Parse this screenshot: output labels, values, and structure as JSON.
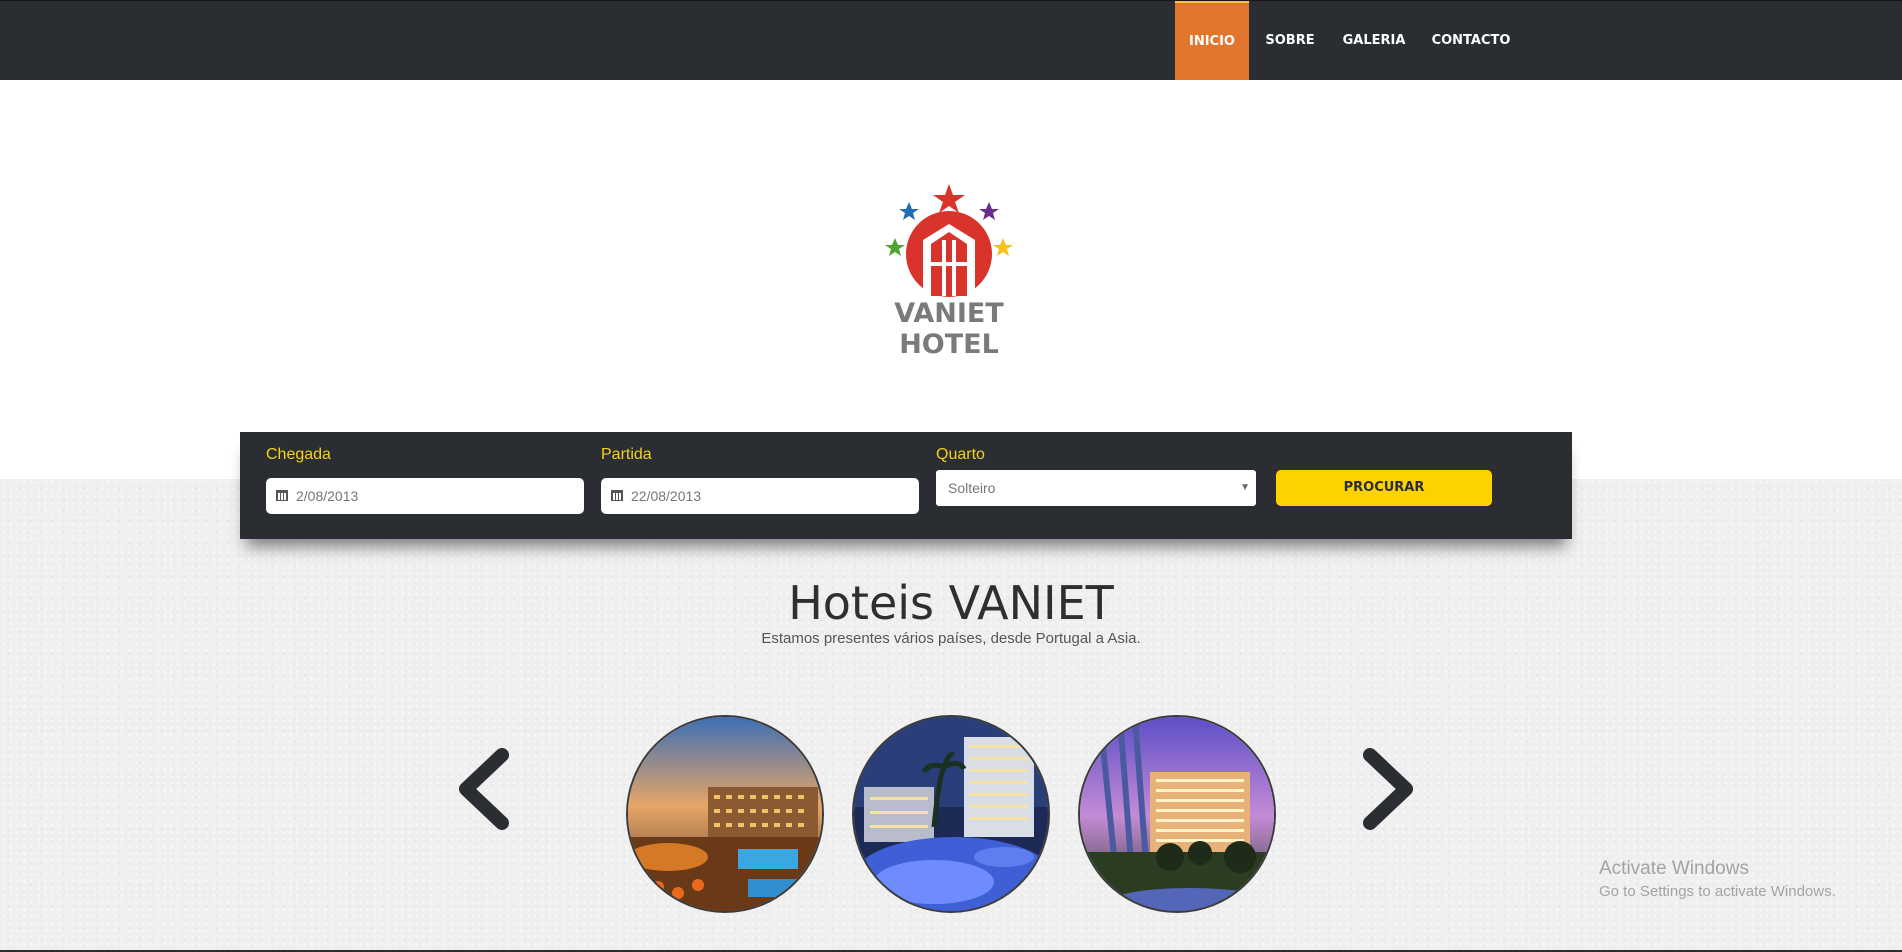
{
  "nav": {
    "items": [
      {
        "label": "INICIO",
        "active": true
      },
      {
        "label": "SOBRE",
        "active": false
      },
      {
        "label": "GALERIA",
        "active": false
      },
      {
        "label": "CONTACTO",
        "active": false
      }
    ]
  },
  "brand": {
    "logo_text": "VANIET HOTEL",
    "star_colors": [
      "#d9342b",
      "#1f6fb5",
      "#6a2d8f",
      "#4fa52f",
      "#f4c21a"
    ],
    "logo_red": "#d9342b"
  },
  "search": {
    "arrival_label": "Chegada",
    "arrival_value": "2/08/2013",
    "departure_label": "Partida",
    "departure_value": "22/08/2013",
    "room_label": "Quarto",
    "room_value": "Solteiro",
    "button_label": "PROCURAR"
  },
  "hero": {
    "title": "Hoteis VANIET",
    "subtitle": "Estamos presentes vários países, desde Portugal a Asia."
  },
  "carousel": {
    "prev_icon": "chevron-left-icon",
    "next_icon": "chevron-right-icon"
  },
  "watermark": {
    "title": "Activate Windows",
    "subtitle": "Go to Settings to activate Windows."
  },
  "colors": {
    "dark": "#2a2d31",
    "accent_orange": "#e3762d",
    "accent_yellow": "#fcd300",
    "label_yellow": "#f4d21a"
  }
}
